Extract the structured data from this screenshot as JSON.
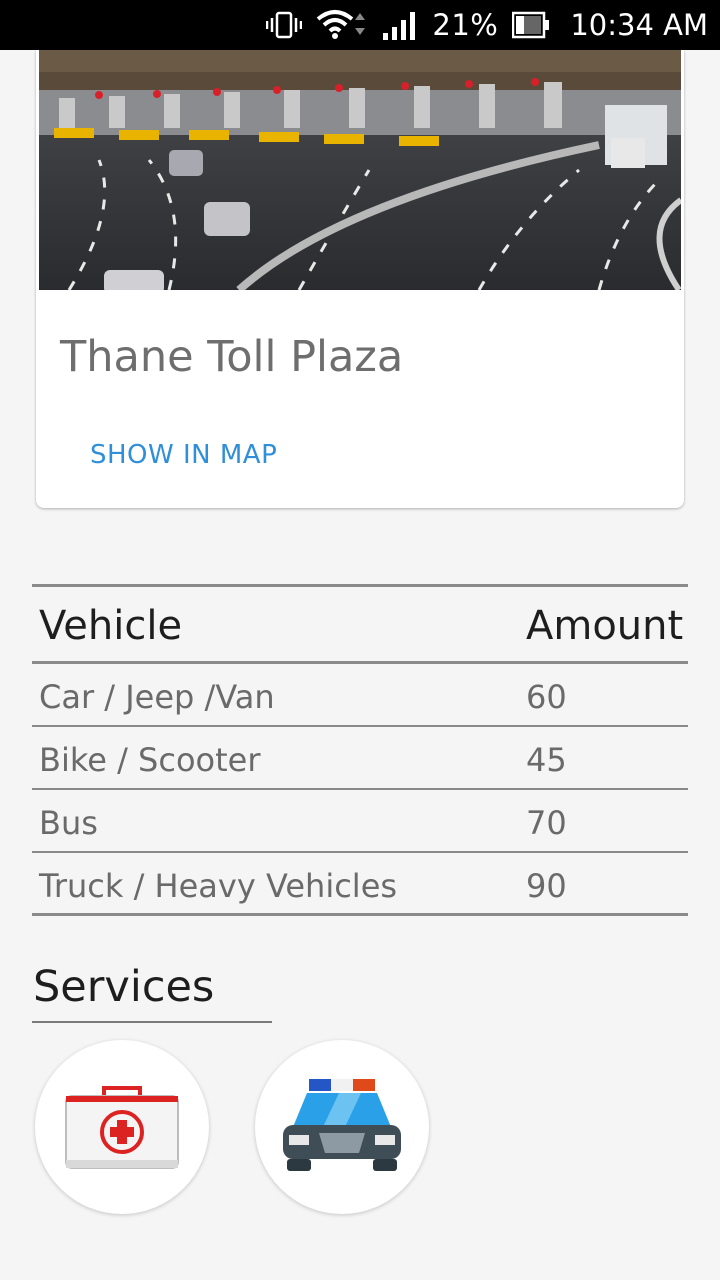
{
  "status_bar": {
    "battery": "21%",
    "time": "10:34 AM",
    "icons": [
      "vibrate-icon",
      "wifi-icon",
      "signal-icon",
      "battery-icon"
    ]
  },
  "card": {
    "image_subject": "toll-plaza-photo",
    "title": "Thane Toll Plaza",
    "map_button": "SHOW IN MAP",
    "accent_color": "#2f8fd8"
  },
  "fare_table": {
    "headers": {
      "vehicle": "Vehicle",
      "amount": "Amount"
    },
    "rows": [
      {
        "vehicle": "Car / Jeep /Van",
        "amount": "60"
      },
      {
        "vehicle": "Bike / Scooter",
        "amount": "45"
      },
      {
        "vehicle": "Bus",
        "amount": "70"
      },
      {
        "vehicle": "Truck / Heavy Vehicles",
        "amount": "90"
      }
    ]
  },
  "services": {
    "title": "Services",
    "items": [
      {
        "name": "medical",
        "icon": "first-aid-kit-icon"
      },
      {
        "name": "police",
        "icon": "police-car-icon"
      }
    ]
  }
}
